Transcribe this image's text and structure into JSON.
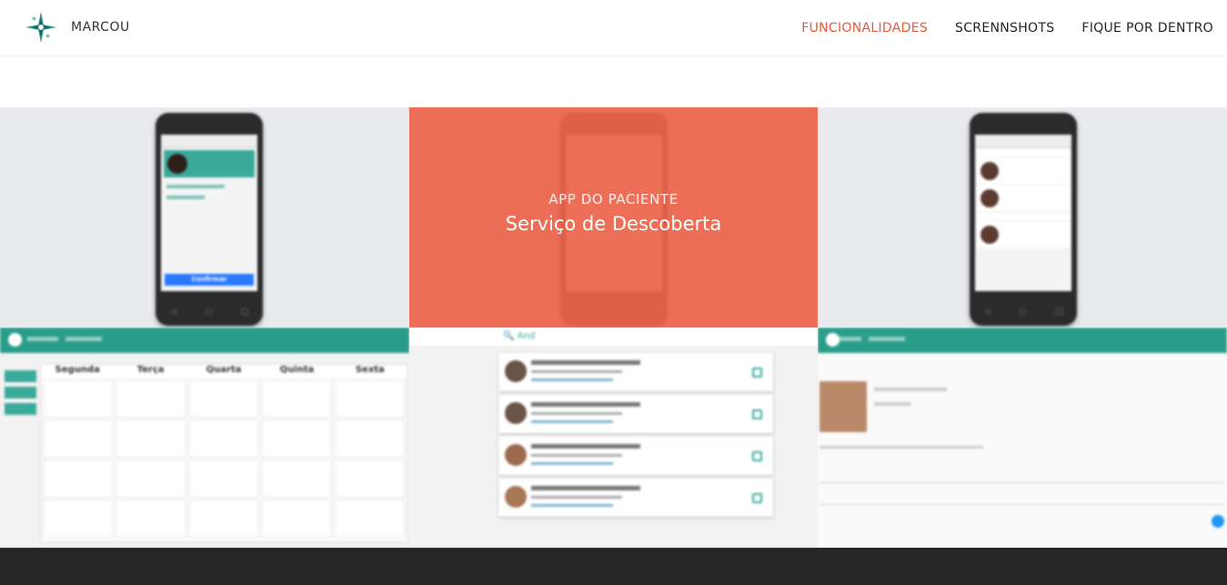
{
  "brand": {
    "name": "MARCOU",
    "logo_icon": "compass-star-icon"
  },
  "nav": {
    "items": [
      {
        "label": "FUNCIONALIDADES",
        "active": true
      },
      {
        "label": "SCRENNSHOTS",
        "active": false
      },
      {
        "label": "FIQUE POR DENTRO",
        "active": false
      }
    ]
  },
  "gallery": {
    "overlay": {
      "kicker": "APP DO PACIENTE",
      "title": "Serviço de Descoberta"
    },
    "tiles": {
      "phone_confirm": {
        "confirm_button": "Confirmar"
      },
      "calendar": {
        "weekdays": [
          "Segunda",
          "Terça",
          "Quarta",
          "Quinta",
          "Sexta"
        ]
      },
      "search": {
        "query": "And"
      }
    }
  },
  "colors": {
    "accent": "#e5573a",
    "overlay": "#ec644b",
    "teal": "#2a9d8a",
    "footer": "#262626"
  }
}
